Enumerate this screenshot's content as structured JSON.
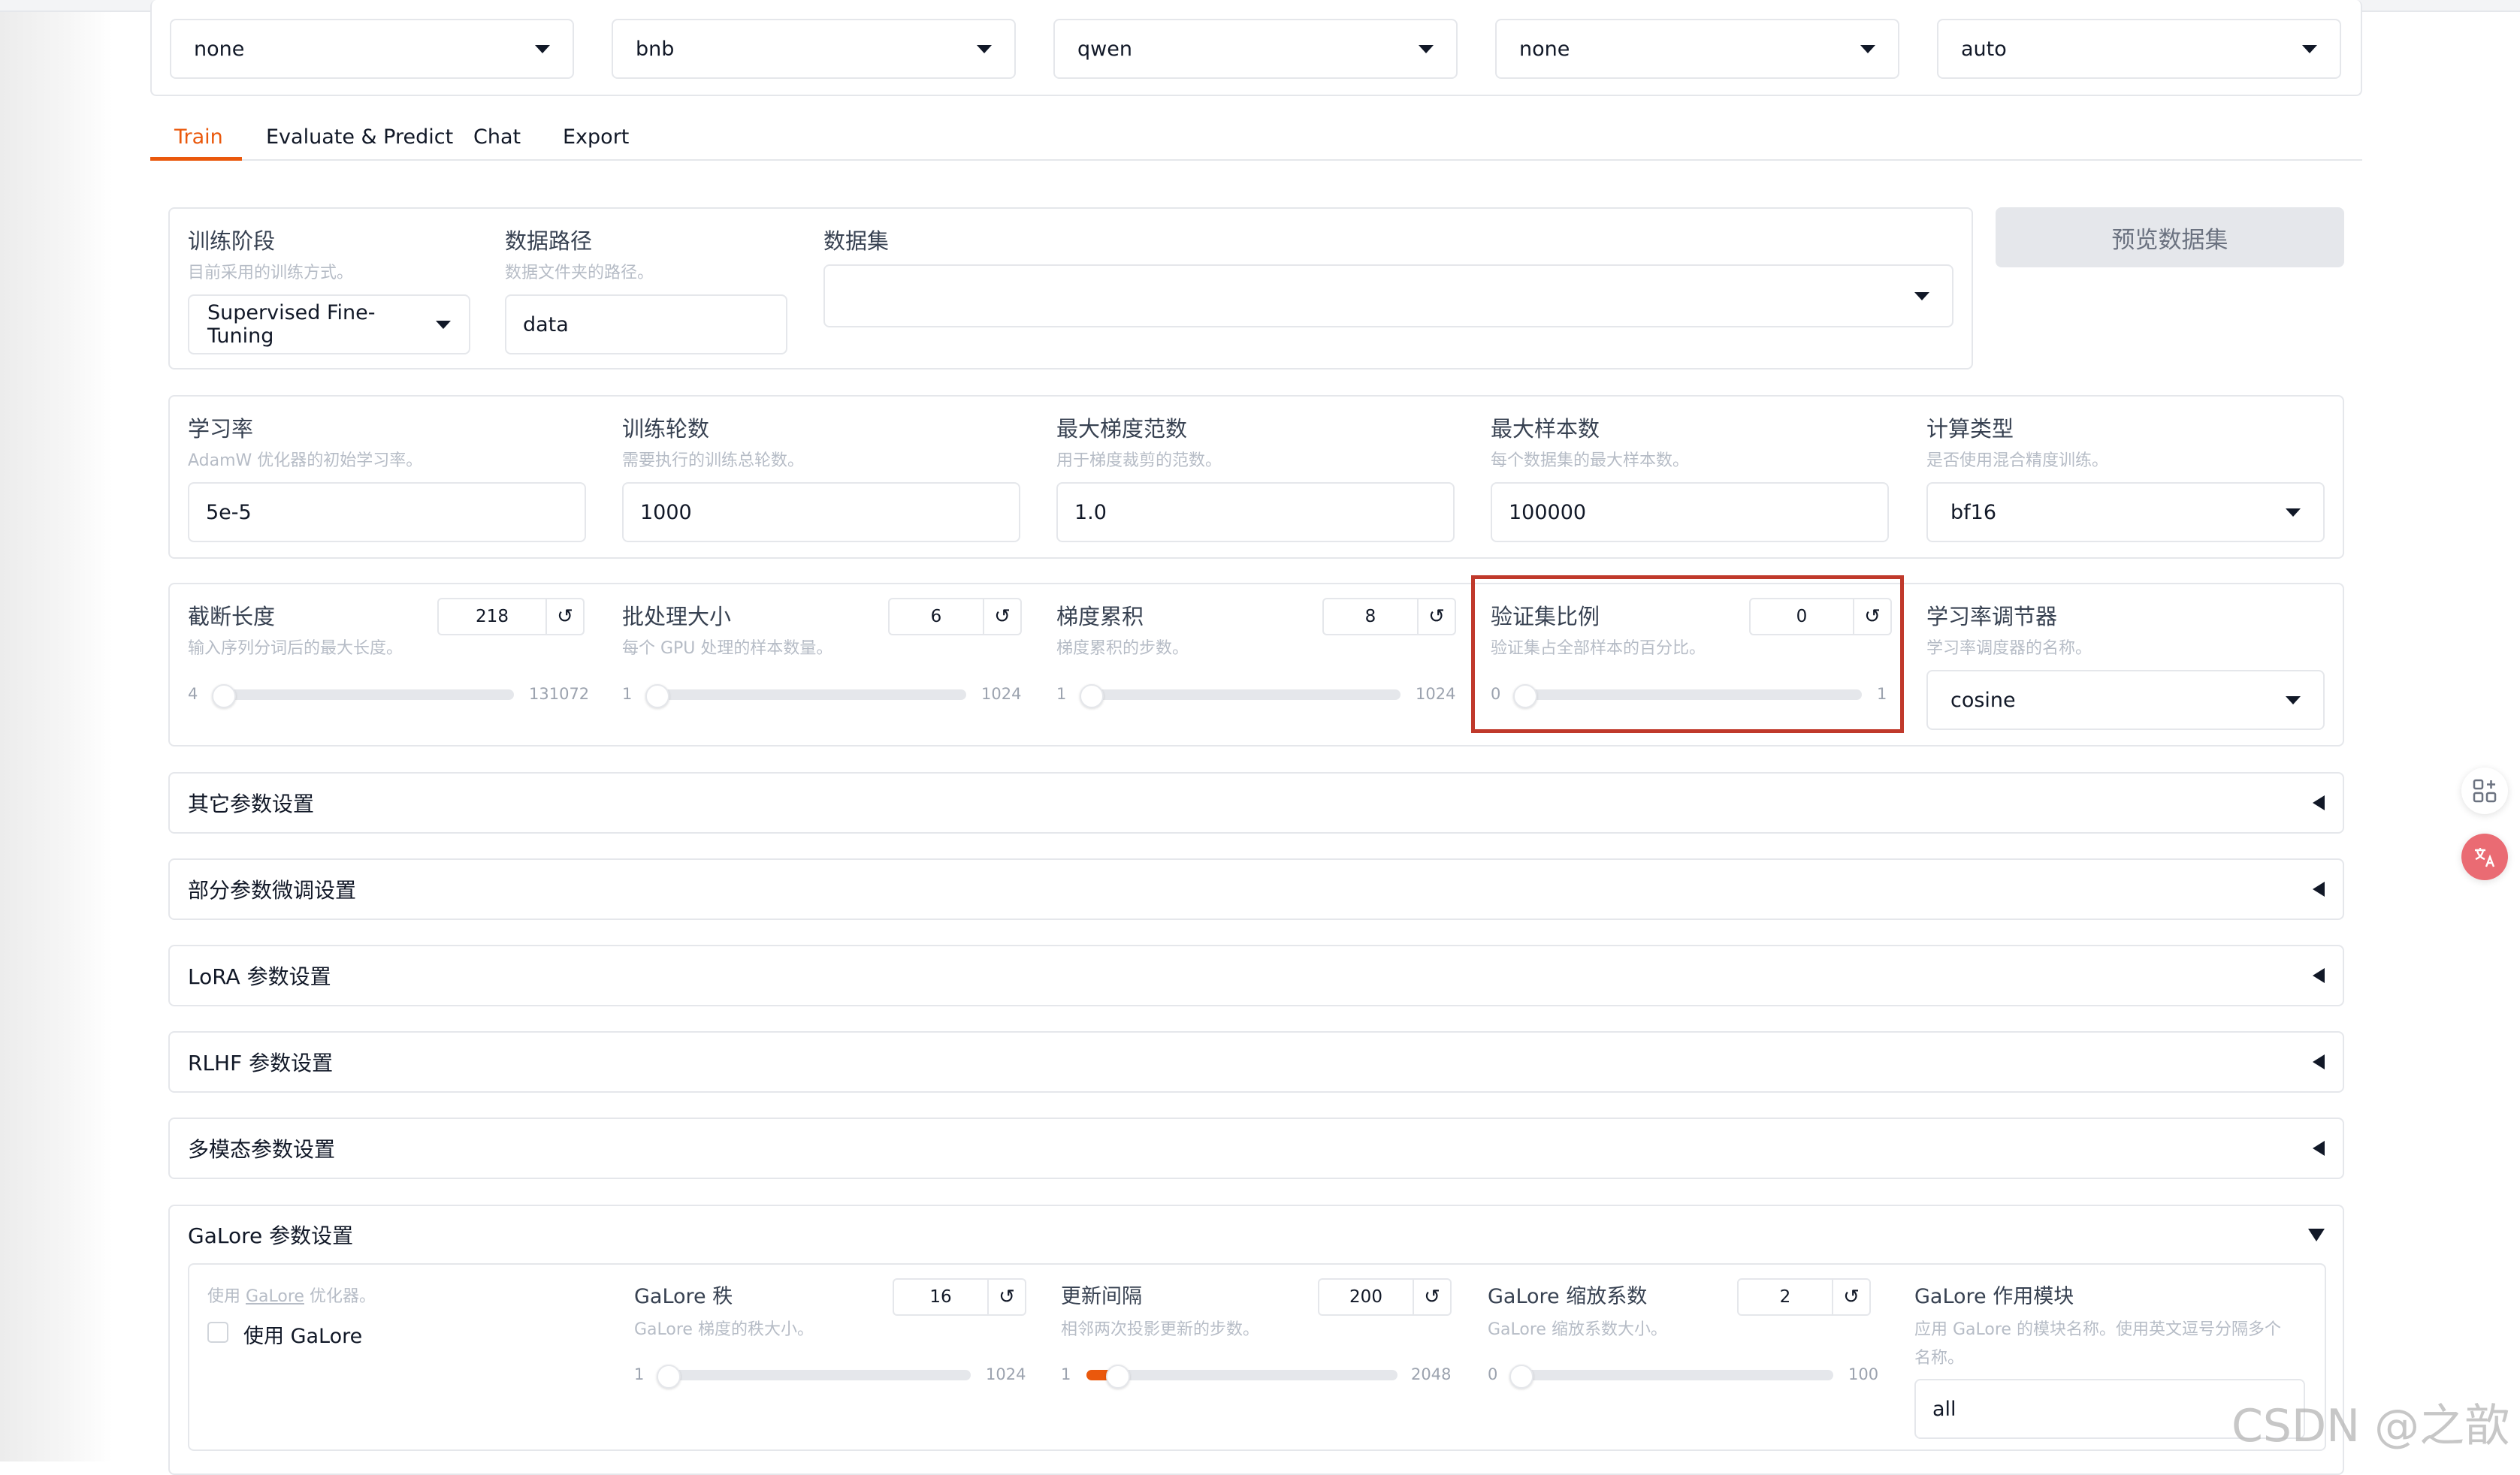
{
  "top_dropdowns": [
    "none",
    "bnb",
    "qwen",
    "none",
    "auto"
  ],
  "tabs": [
    {
      "label": "Train",
      "active": true
    },
    {
      "label": "Evaluate & Predict",
      "active": false
    },
    {
      "label": "Chat",
      "active": false
    },
    {
      "label": "Export",
      "active": false
    }
  ],
  "dataset_row": {
    "stage": {
      "label": "训练阶段",
      "info": "目前采用的训练方式。",
      "value": "Supervised Fine-Tuning"
    },
    "dataset_dir": {
      "label": "数据路径",
      "info": "数据文件夹的路径。",
      "value": "data"
    },
    "dataset": {
      "label": "数据集",
      "value": ""
    },
    "preview_button": "预览数据集"
  },
  "param_row": [
    {
      "label": "学习率",
      "info": "AdamW 优化器的初始学习率。",
      "value": "5e-5"
    },
    {
      "label": "训练轮数",
      "info": "需要执行的训练总轮数。",
      "value": "1000"
    },
    {
      "label": "最大梯度范数",
      "info": "用于梯度裁剪的范数。",
      "value": "1.0"
    },
    {
      "label": "最大样本数",
      "info": "每个数据集的最大样本数。",
      "value": "100000"
    },
    {
      "label": "计算类型",
      "info": "是否使用混合精度训练。",
      "value": "bf16"
    }
  ],
  "slider_row": [
    {
      "label": "截断长度",
      "info": "输入序列分词后的最大长度。",
      "value": "218",
      "min": "4",
      "max": "131072",
      "fraction": 0.0
    },
    {
      "label": "批处理大小",
      "info": "每个 GPU 处理的样本数量。",
      "value": "6",
      "min": "1",
      "max": "1024",
      "fraction": 0.005
    },
    {
      "label": "梯度累积",
      "info": "梯度累积的步数。",
      "value": "8",
      "min": "1",
      "max": "1024",
      "fraction": 0.007
    },
    {
      "label": "验证集比例",
      "info": "验证集占全部样本的百分比。",
      "value": "0",
      "min": "0",
      "max": "1",
      "fraction": 0.0
    }
  ],
  "scheduler": {
    "label": "学习率调节器",
    "info": "学习率调度器的名称。",
    "value": "cosine"
  },
  "accordions": [
    "其它参数设置",
    "部分参数微调设置",
    "LoRA 参数设置",
    "RLHF 参数设置",
    "多模态参数设置"
  ],
  "galore": {
    "title": "GaLore 参数设置",
    "use_info_prefix": "使用 ",
    "use_info_link": "GaLore",
    "use_info_suffix": " 优化器。",
    "use_label": "使用 GaLore",
    "sliders": [
      {
        "label": "GaLore 秩",
        "info": "GaLore 梯度的秩大小。",
        "value": "16",
        "min": "1",
        "max": "1024",
        "fraction": 0.015
      },
      {
        "label": "更新间隔",
        "info": "相邻两次投影更新的步数。",
        "value": "200",
        "min": "1",
        "max": "2048",
        "fraction": 0.097
      },
      {
        "label": "GaLore 缩放系数",
        "info": "GaLore 缩放系数大小。",
        "value": "2",
        "min": "0",
        "max": "100",
        "fraction": 0.02
      }
    ],
    "target": {
      "label": "GaLore 作用模块",
      "info_line1": "应用 GaLore 的模块名称。使用英文逗号分隔多个",
      "info_line2": "名称。",
      "value": "all"
    }
  },
  "watermark": "CSDN @之歆"
}
